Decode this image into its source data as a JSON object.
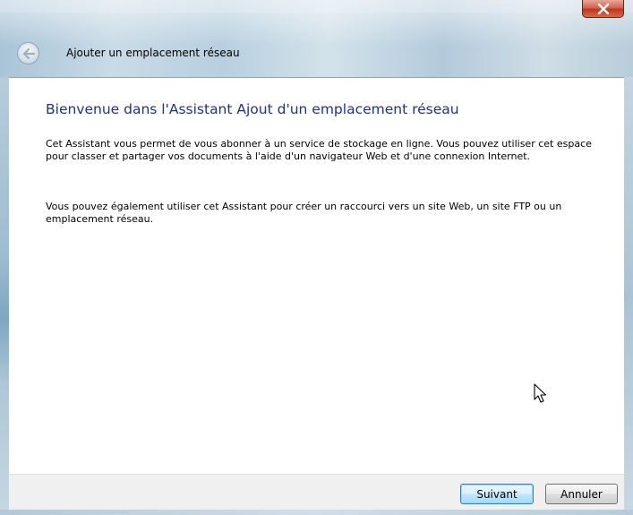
{
  "window": {
    "title": "Ajouter un emplacement réseau",
    "close_icon": "close-icon",
    "back_icon": "back-arrow-icon"
  },
  "main": {
    "heading": "Bienvenue dans l'Assistant Ajout d'un emplacement réseau",
    "paragraphs": [
      "Cet Assistant vous permet de vous abonner à un service de stockage en ligne. Vous pouvez utiliser cet espace pour classer et partager vos documents à l'aide d'un navigateur Web et d'une connexion Internet.",
      "Vous pouvez également utiliser cet Assistant pour créer un raccourci vers un site Web, un site FTP ou un emplacement réseau."
    ]
  },
  "footer": {
    "next_label": "Suivant",
    "cancel_label": "Annuler"
  },
  "colors": {
    "heading": "#1e3287",
    "footer_bg": "#f0f0f0",
    "close_button": "#c0361f"
  }
}
